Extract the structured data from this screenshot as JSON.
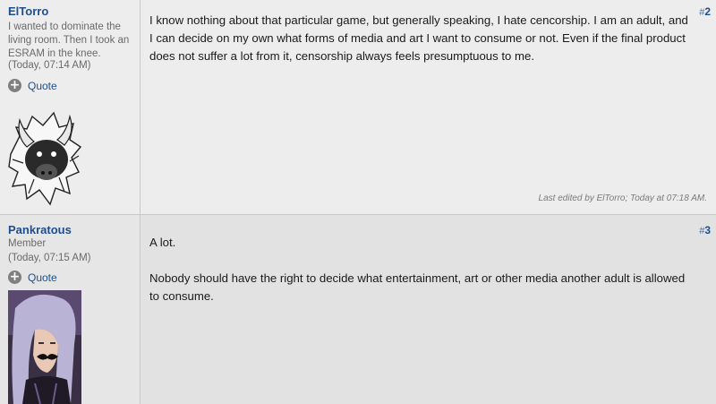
{
  "posts": [
    {
      "username": "ElTorro",
      "user_title": "I wanted to dominate the living room. Then I took an ESRAM in the knee.",
      "time": "(Today, 07:14 AM)",
      "quote_label": "Quote",
      "post_number_prefix": "#",
      "post_number": "2",
      "paragraphs": [
        "I know nothing about that particular game, but generally speaking, I hate cencorship. I am an adult, and I can decide on my own what forms of media and art I want to consume or not. Even if the final product does not suffer a lot from it, censorship always feels presumptuous to me."
      ],
      "edited_note": "Last edited by ElTorro; Today at 07:18 AM."
    },
    {
      "username": "Pankratous",
      "user_title": "Member",
      "time": "(Today, 07:15 AM)",
      "quote_label": "Quote",
      "post_number_prefix": "#",
      "post_number": "3",
      "paragraphs": [
        "A lot.",
        "Nobody should have the right to decide what entertainment, art or other media another adult is allowed to consume."
      ]
    }
  ],
  "colors": {
    "link": "#1f4e8c",
    "muted": "#6a6a6a"
  }
}
